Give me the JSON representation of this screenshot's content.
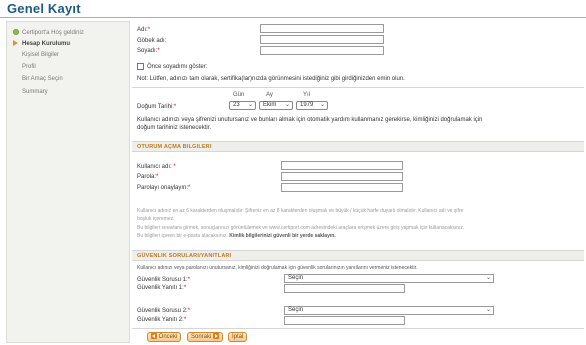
{
  "page": {
    "title": "Genel Kayıt"
  },
  "sidebar": {
    "items": [
      {
        "label": "Certiport'a Hoş geldiniz",
        "icon": "check-circle-icon",
        "state": "done"
      },
      {
        "label": "Hesap Kurulumu",
        "icon": "arrow-right-icon",
        "state": "active"
      },
      {
        "label": "Kişisel Bilgiler",
        "state": "pending"
      },
      {
        "label": "Profil",
        "state": "pending"
      },
      {
        "label": "Bir Amaç Seçin",
        "state": "pending"
      },
      {
        "label": "Summary",
        "state": "pending"
      }
    ]
  },
  "name": {
    "first_label": "Adı:",
    "middle_label": "Göbek adı:",
    "last_label": "Soyadı:",
    "required_mark": "*",
    "surname_first_label": "Önce soyadımı göster:",
    "note": "Not: Lütfen, adınızı tam olarak, sertifika(lar)nızda görünmesini istediğiniz gibi girdiğinizden emin olun."
  },
  "birth": {
    "label": "Doğum Tarihi:",
    "day_caption": "Gün",
    "month_caption": "Ay",
    "year_caption": "Yıl",
    "day_value": "23",
    "month_value": "Ekim",
    "year_value": "1979",
    "note_line1": "Kullanıcı adınızı veya şifrenizi unutursanız ve bunları almak için otomatik yardım kullanmanız gerekirse, kimliğinizi doğrulamak için",
    "note_line2": "doğum tarihiniz istenecektir."
  },
  "login": {
    "section_title": "OTURUM AÇMA BILGILERI",
    "username_label": "Kullanıcı adı:",
    "password_label": "Parola:",
    "confirm_label": "Parolayı onaylayın:",
    "hint_line1": "Kullanıcı adınız en az 6 karakterden oluşmalıdır. Şifreniz en az 8 karakterden oluşmalı ve büyük / küçük harfe duyarlı olmalıdır. Kullanıcı adı ve şifre",
    "hint_line2": "boşluk içeremez.",
    "hint_line3": "Bu bilgileri sınavlara girmek, sonuçlarınızı görüntülemek ve www.certiport.com adresindeki araçlara erişmek üzere giriş yapmak için kullanacaksınız.",
    "hint_line4_plain": "Bu bilgileri içeren bir e-posta alacaksınız.",
    "hint_line4_bold": "Kimlik bilgilerinizi güvenli bir yerde saklayın."
  },
  "security": {
    "section_title": "GÜVENLIK SORULARI/YANITLARI",
    "intro": "Kullanıcı adınızı veya parolanızı unutursanız, kimliğinizi doğrulamak için güvenlik sorularınızın yanıtlarını vermeniz istenecektir.",
    "q1_label": "Güvenlik Sorusu 1:",
    "a1_label": "Güvenlik Yanıtı 1:",
    "q2_label": "Güvenlik Sorusu 2:",
    "a2_label": "Güvenlik Yanıtı 2:",
    "q1_value": "Seçin",
    "q2_value": "Seçin"
  },
  "nav": {
    "prev_label": "Önceki",
    "next_label": "Sonraki",
    "cancel_label": "İptal"
  }
}
